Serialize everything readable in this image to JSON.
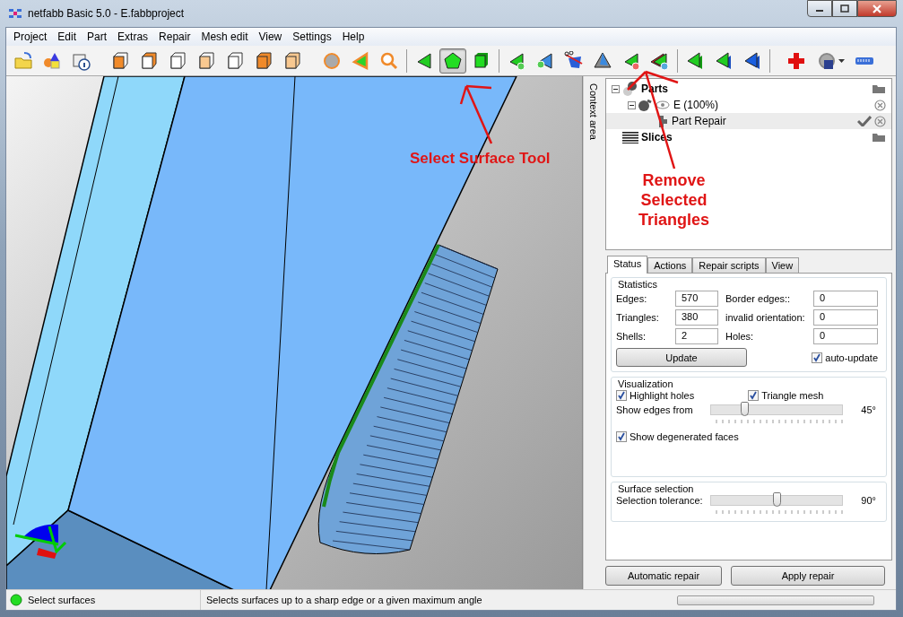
{
  "window": {
    "title": "netfabb Basic 5.0 - E.fabbproject"
  },
  "menu": [
    {
      "label": "Project"
    },
    {
      "label": "Edit"
    },
    {
      "label": "Part"
    },
    {
      "label": "Extras"
    },
    {
      "label": "Repair"
    },
    {
      "label": "Mesh edit"
    },
    {
      "label": "View"
    },
    {
      "label": "Settings"
    },
    {
      "label": "Help"
    }
  ],
  "toolbar": [
    [
      {
        "selected": false
      },
      {
        "selected": false
      },
      {
        "selected": false
      }
    ],
    [
      {
        "selected": false
      },
      {
        "selected": false
      },
      {
        "selected": false
      },
      {
        "selected": false
      },
      {
        "selected": false
      },
      {
        "selected": false
      },
      {
        "selected": false
      }
    ],
    [
      {
        "selected": false
      },
      {
        "selected": false
      },
      {
        "selected": false
      }
    ],
    [
      {
        "selected": false
      },
      {
        "selected": true
      },
      {
        "selected": false
      }
    ],
    [
      {
        "selected": false
      },
      {
        "selected": false
      },
      {
        "selected": false
      },
      {
        "selected": false
      },
      {
        "selected": false
      },
      {
        "selected": false
      }
    ],
    [
      {
        "selected": false
      },
      {
        "selected": false
      },
      {
        "selected": false
      }
    ],
    [
      {
        "selected": false
      },
      {
        "selected": false
      },
      {
        "selected": false
      }
    ]
  ],
  "annotations": [
    {
      "text": "Select Surface Tool"
    },
    {
      "text": "Remove Selected Triangles"
    }
  ],
  "context_area": {
    "label": "Context area"
  },
  "tree": [
    {
      "kind": "parts",
      "label": "Parts",
      "expanded": true,
      "selected": false,
      "children": [
        {
          "kind": "part",
          "label": "E (100%)",
          "expanded": true,
          "selected": false,
          "children": [
            {
              "kind": "repair",
              "label": "Part Repair",
              "selected": true
            }
          ]
        }
      ]
    },
    {
      "kind": "slices",
      "label": "Slices",
      "selected": false
    }
  ],
  "tabs": [
    {
      "label": "Status",
      "selected": true
    },
    {
      "label": "Actions",
      "selected": false
    },
    {
      "label": "Repair scripts",
      "selected": false
    },
    {
      "label": "View",
      "selected": false
    }
  ],
  "statistics": {
    "title": "Statistics",
    "fields": [
      {
        "label": "Edges:",
        "value": "570"
      },
      {
        "label": "Border edges::",
        "value": "0"
      },
      {
        "label": "Triangles:",
        "value": "380"
      },
      {
        "label": "invalid orientation:",
        "value": "0"
      },
      {
        "label": "Shells:",
        "value": "2"
      },
      {
        "label": "Holes:",
        "value": "0"
      }
    ],
    "update_button": "Update",
    "auto_update": {
      "label": "auto-update",
      "checked": true
    }
  },
  "visualization": {
    "title": "Visualization",
    "highlight_holes": {
      "label": "Highlight holes",
      "checked": true
    },
    "triangle_mesh": {
      "label": "Triangle mesh",
      "checked": true
    },
    "edges_slider": {
      "label": "Show edges from",
      "level": 0.25,
      "reading": "45°"
    },
    "degenerated_faces": {
      "label": "Show degenerated faces",
      "checked": true
    }
  },
  "surface_selection": {
    "title": "Surface selection",
    "slider": {
      "label": "Selection tolerance:",
      "level": 0.5,
      "reading": "90°"
    }
  },
  "buttons": [
    {
      "label": "Automatic repair"
    },
    {
      "label": "Apply repair"
    }
  ],
  "status_bar": {
    "mode": "Select surfaces",
    "message": "Selects surfaces up to a sharp edge or a given maximum angle",
    "progress": {
      "level": 0
    }
  }
}
